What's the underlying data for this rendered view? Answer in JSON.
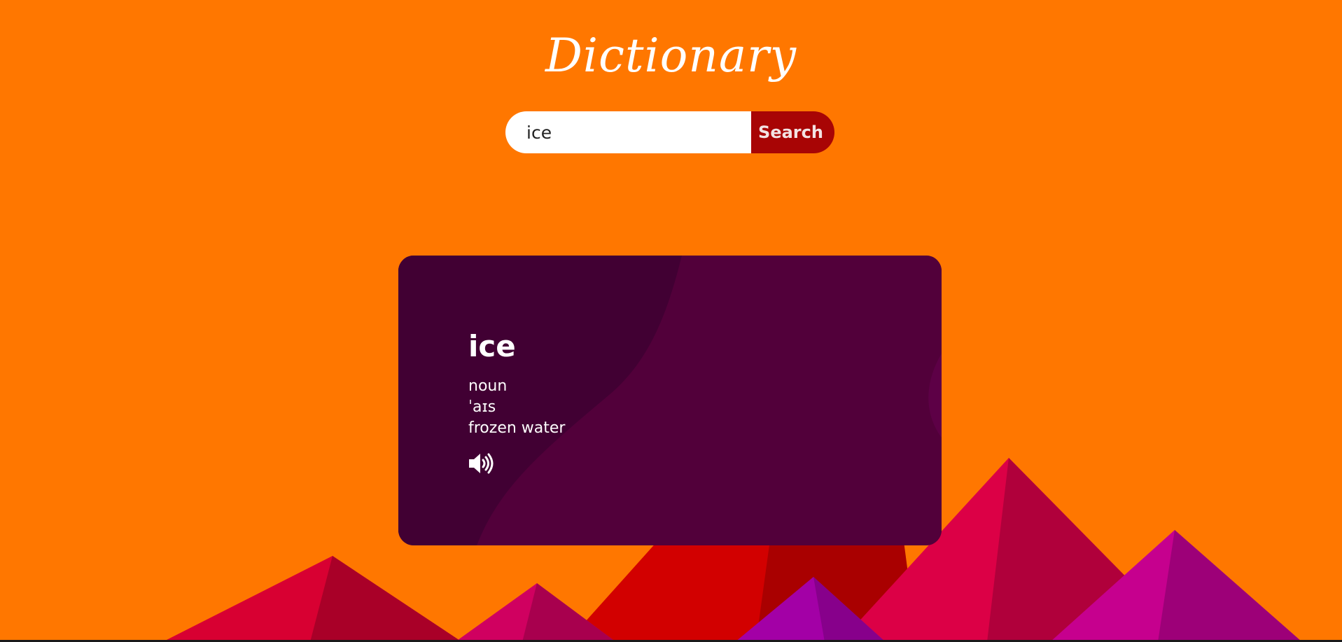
{
  "header": {
    "title": "Dictionary"
  },
  "search": {
    "value": "ice",
    "button_label": "Search"
  },
  "result": {
    "word": "ice",
    "part_of_speech": "noun",
    "phonetic": "ˈaɪs",
    "definition": "frozen water",
    "audio_icon": "speaker-volume-icon"
  },
  "colors": {
    "background": "#ff7700",
    "search_button": "#a80505",
    "card": "#52003a",
    "card_shade": "#410033"
  }
}
